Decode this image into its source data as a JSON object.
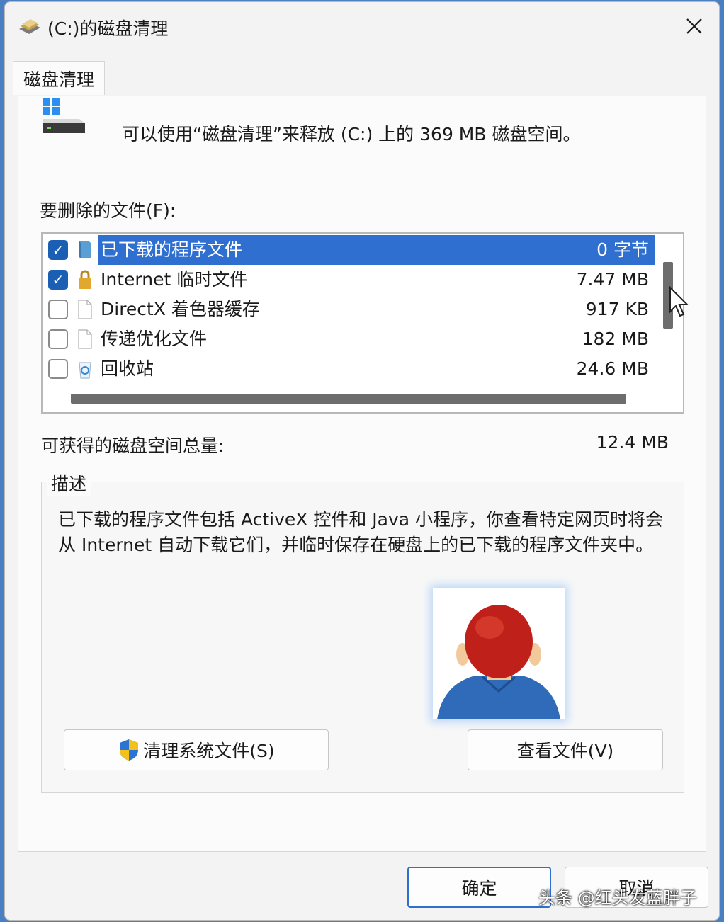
{
  "window": {
    "title": "(C:)的磁盘清理",
    "close_icon": "close-icon"
  },
  "tab": {
    "label": "磁盘清理"
  },
  "intro": {
    "text": "可以使用“磁盘清理”来释放 (C:) 上的 369 MB 磁盘空间。",
    "icon": "drive-icon"
  },
  "file_list": {
    "label": "要删除的文件(F):",
    "items": [
      {
        "name": "已下载的程序文件",
        "size": "0 字节",
        "checked": true,
        "selected": true,
        "icon": "downloaded-program-files-icon"
      },
      {
        "name": "Internet 临时文件",
        "size": "7.47 MB",
        "checked": true,
        "selected": false,
        "icon": "lock-icon"
      },
      {
        "name": "DirectX 着色器缓存",
        "size": "917 KB",
        "checked": false,
        "selected": false,
        "icon": "file-icon"
      },
      {
        "name": "传递优化文件",
        "size": "182 MB",
        "checked": false,
        "selected": false,
        "icon": "file-icon"
      },
      {
        "name": "回收站",
        "size": "24.6 MB",
        "checked": false,
        "selected": false,
        "icon": "recycle-bin-icon"
      }
    ]
  },
  "total": {
    "label": "可获得的磁盘空间总量:",
    "value": "12.4 MB"
  },
  "description": {
    "legend": "描述",
    "text": "已下载的程序文件包括 ActiveX 控件和 Java 小程序，你查看特定网页时将会从 Internet 自动下载它们，并临时保存在硬盘上的已下载的程序文件夹中。"
  },
  "buttons": {
    "clean_system": "清理系统文件(S)",
    "view_files": "查看文件(V)",
    "ok": "确定",
    "cancel": "取消"
  },
  "watermark": "头条 @红头发蓝胖子",
  "colors": {
    "selection": "#2f6fd0",
    "checkbox_checked": "#1a5fb4",
    "window_bg": "#f3f3f3"
  }
}
